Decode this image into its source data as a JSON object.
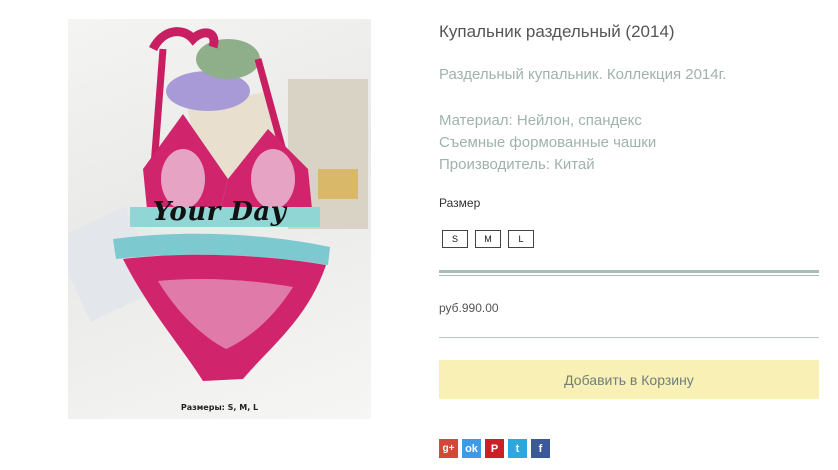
{
  "product": {
    "title": "Купальник раздельный (2014)",
    "subtitle": "Раздельный купальник. Коллекция 2014г.",
    "specs": [
      "Материал: Нейлон, спандекс",
      "Съемные формованные чашки",
      "Производитель: Китай"
    ],
    "image": {
      "brand_text": "Your Day",
      "sizes_caption": "Размеры: S, M, L"
    }
  },
  "size_selector": {
    "label": "Размер",
    "options": [
      "S",
      "M",
      "L"
    ]
  },
  "price": "руб.990.00",
  "cart": {
    "button_label": "Добавить в Корзину"
  },
  "share": {
    "icons": [
      "google-plus-icon",
      "odnoklassniki-icon",
      "pinterest-icon",
      "twitter-icon",
      "facebook-icon"
    ],
    "gplus_glyph": "g+",
    "ok_glyph": "ok",
    "pin_glyph": "P",
    "tw_glyph": "t",
    "fb_glyph": "f"
  },
  "colors": {
    "accent_text": "#9fb3aa",
    "cart_button": "#f8f0b4",
    "swimsuit": "#d0256d"
  }
}
